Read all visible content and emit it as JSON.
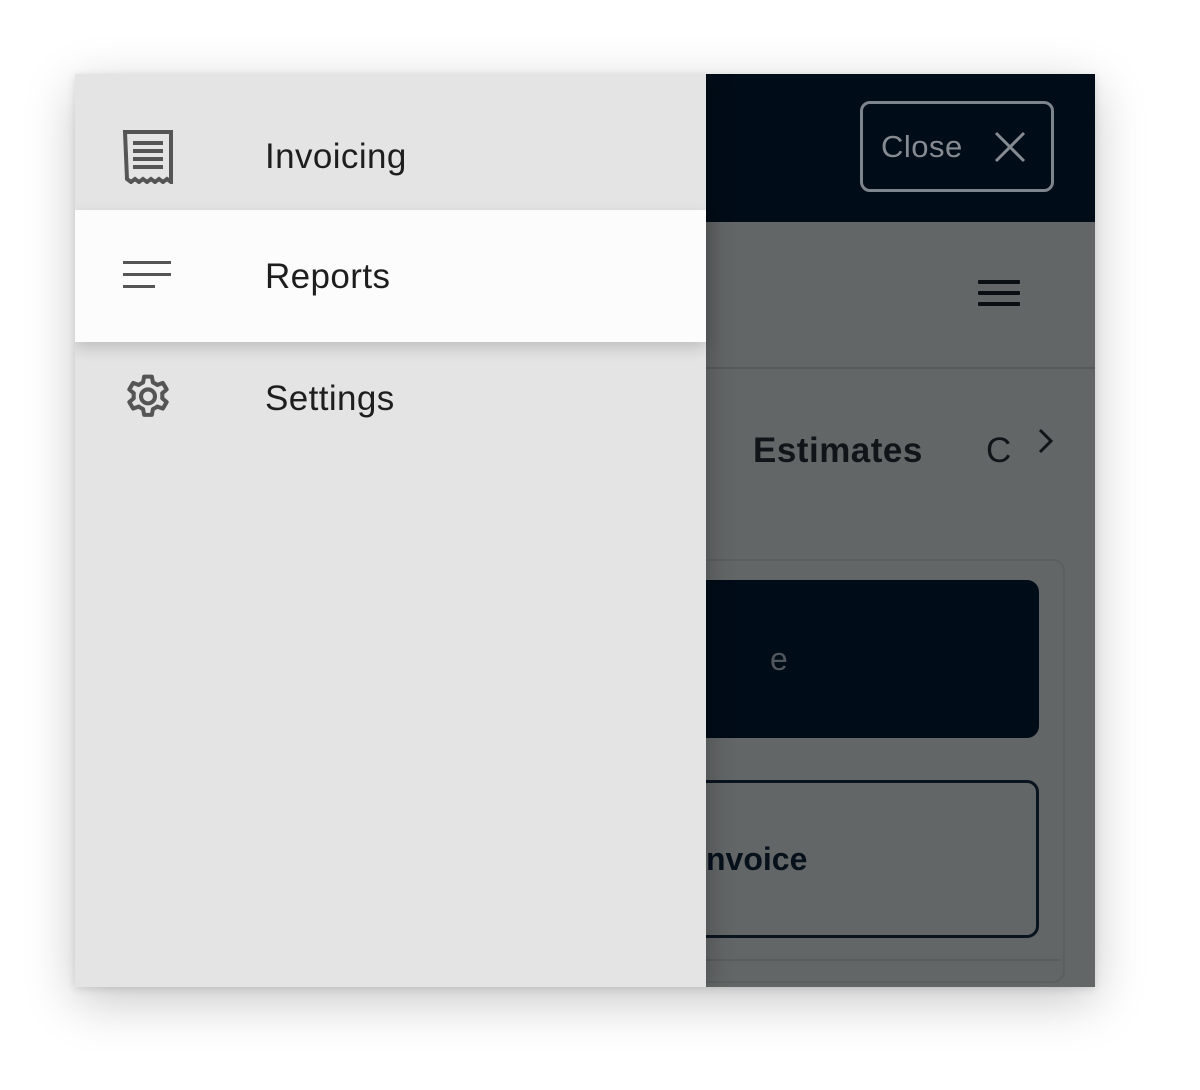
{
  "header": {
    "close_label": "Close",
    "close_icon": "close-icon",
    "menu_icon": "hamburger-icon"
  },
  "tabs": {
    "items": [
      {
        "label": "Estimates"
      },
      {
        "label": "C"
      }
    ],
    "next_icon": "chevron-right-icon"
  },
  "actions": {
    "primary_label_fragment": "e",
    "secondary_label_fragment": "nvoice"
  },
  "drawer": {
    "items": [
      {
        "label": "Invoicing",
        "icon": "receipt-icon",
        "selected": false
      },
      {
        "label": "Reports",
        "icon": "sort-lines-icon",
        "selected": true
      },
      {
        "label": "Settings",
        "icon": "gear-icon",
        "selected": false
      }
    ]
  },
  "colors": {
    "header_bg": "#000c18",
    "drawer_bg": "#e4e4e4",
    "selected_item_bg": "#fcfcfc",
    "overlay_bg": "#636666",
    "icon_color": "#555555"
  }
}
